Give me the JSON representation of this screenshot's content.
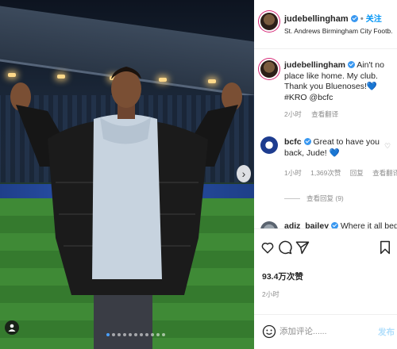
{
  "post": {
    "username": "judebellingham",
    "follow_label": "关注",
    "location": "St. Andrews Birmingham City Footb..."
  },
  "caption": {
    "username": "judebellingham",
    "text": "Ain't no place like home. My club. Thank you Bluenoses!💙#KRO @bcfc",
    "time": "2小时",
    "translate": "查看翻译"
  },
  "comments": [
    {
      "username": "bcfc",
      "text": "Great to have you back, Jude! 💙",
      "time": "1小时",
      "likes": "1,369次赞",
      "reply": "回复",
      "translate": "查看翻译",
      "view_replies": "查看回复 (9)"
    },
    {
      "username": "adiz_bailey",
      "text": "Where it all began"
    }
  ],
  "stats": {
    "likes": "93.4万次赞",
    "time": "2小时"
  },
  "composer": {
    "placeholder": "添加评论......",
    "post_label": "发布"
  },
  "icons": [
    "heart-icon",
    "comment-icon",
    "share-icon",
    "bookmark-icon",
    "emoji-icon",
    "verified-icon",
    "user-tag-icon",
    "next-arrow-icon"
  ],
  "colors": {
    "link": "#0095f6",
    "verified": "#3897f0",
    "post_disabled": "#b2dffc",
    "muted": "#8e8e8e"
  },
  "carousel": {
    "slides": 11,
    "active": 1
  }
}
